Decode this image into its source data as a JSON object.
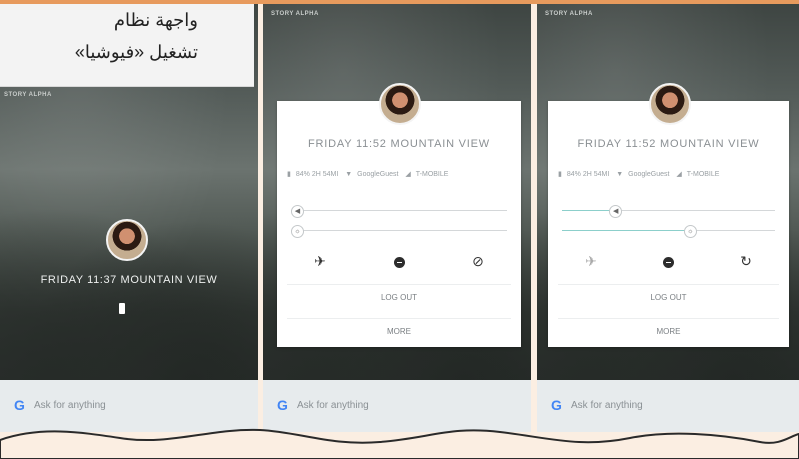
{
  "callout": {
    "line1": "واجهة نظام",
    "line2": "تشغيل «فيوشيا»"
  },
  "panels": [
    {
      "brand": "STORY ALPHA",
      "lock_text": "FRIDAY 11:37 MOUNTAIN VIEW",
      "search_placeholder": "Ask for anything"
    },
    {
      "brand": "STORY ALPHA",
      "card_title": "FRIDAY 11:52 MOUNTAIN VIEW",
      "battery": "84% 2H 54MI",
      "wifi": "GoogleGuest",
      "carrier": "T-MOBILE",
      "volume_level": 0.0,
      "brightness_level": 0.0,
      "logout": "LOG OUT",
      "more": "MORE",
      "search_placeholder": "Ask for anything"
    },
    {
      "brand": "STORY ALPHA",
      "card_title": "FRIDAY 11:52 MOUNTAIN VIEW",
      "battery": "84% 2H 54MI",
      "wifi": "GoogleGuest",
      "carrier": "T-MOBILE",
      "volume_level": 0.25,
      "brightness_level": 0.6,
      "logout": "LOG OUT",
      "more": "MORE",
      "search_placeholder": "Ask for anything"
    }
  ],
  "google_logo": "G",
  "colors": {
    "accent": "#e79a5d",
    "slider_fill": "#8ccfcb",
    "background": "#fbeee2"
  }
}
